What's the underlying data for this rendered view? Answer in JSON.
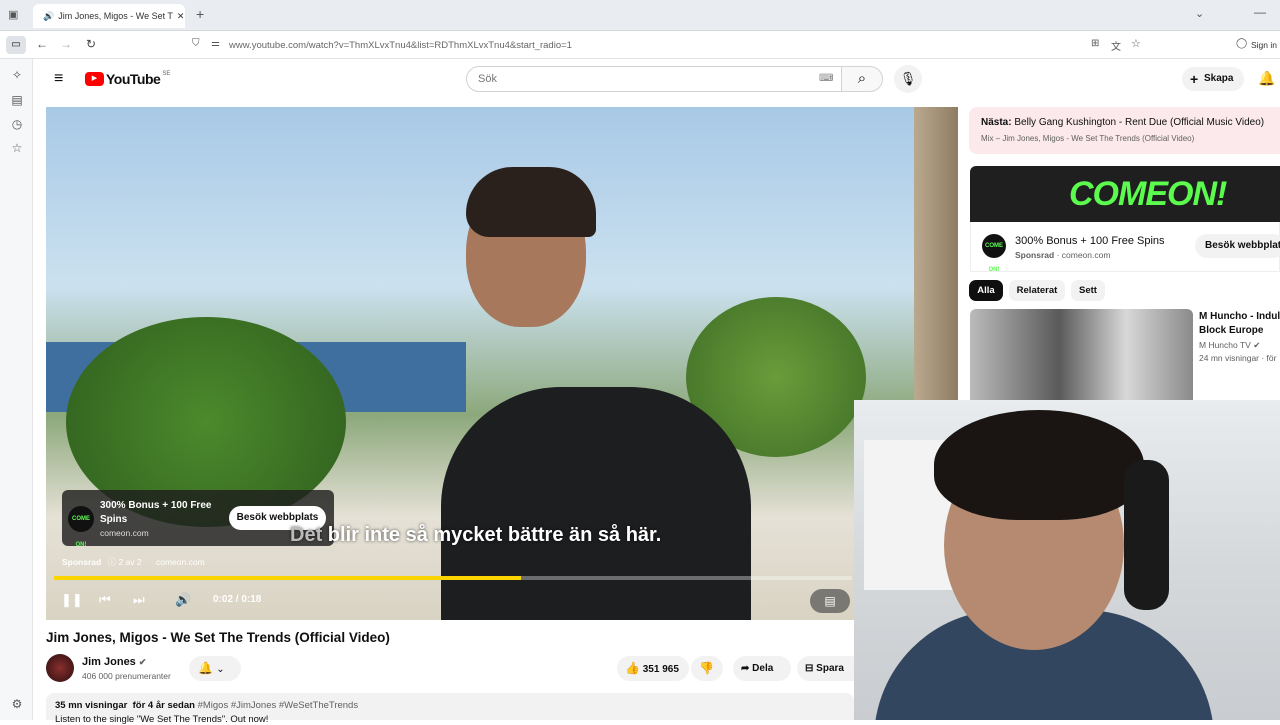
{
  "browser": {
    "tab_title": "Jim Jones, Migos - We Set T",
    "url": "www.youtube.com/watch?v=ThmXLvxTnu4&list=RDThmXLvxTnu4&start_radio=1",
    "sign_in": "Sign in"
  },
  "header": {
    "logo": "YouTube",
    "region": "SE",
    "search_placeholder": "Sök",
    "create_label": "Skapa"
  },
  "player": {
    "ad_title": "300% Bonus + 100 Free Spins",
    "ad_domain": "comeon.com",
    "ad_button": "Besök webbplats",
    "subtitle_dim": "Det",
    "subtitle_text": " blir inte så mycket bättre än så här.",
    "sponsored": "Sponsrad",
    "ad_count": "2 av 2",
    "sponsor_domain": "comeon.com",
    "time": "0:02 / 0:18",
    "progress": 0.585,
    "ad_logo_text": "COME ON!"
  },
  "video": {
    "title": "Jim Jones, Migos - We Set The Trends (Official Video)",
    "channel": "Jim Jones",
    "subscribers": "406 000 prenumeranter",
    "likes": "351 965",
    "share": "Dela",
    "save": "Spara",
    "views": "35 mn visningar",
    "age": "för 4 år sedan",
    "tags": "#Migos #JimJones #WeSetTheTrends",
    "desc_line2": "Listen to the single \"We Set The Trends\". Out now!"
  },
  "side": {
    "next_label": "Nästa:",
    "next_title": "Belly Gang Kushington - Rent Due (Official Music Video)",
    "next_sub": "Mix – Jim Jones, Migos - We Set The Trends (Official Video)",
    "banner_text": "COMEON!",
    "ad_title": "300% Bonus + 100 Free Spins",
    "ad_sponsored": "Sponsrad",
    "ad_domain": "comeon.com",
    "ad_button": "Besök webbplats",
    "chips": [
      "Alla",
      "Relaterat",
      "Sett"
    ],
    "related_title_1": "M Huncho - Indulg",
    "related_title_2": "Block Europe",
    "related_channel": "M Huncho TV",
    "related_meta": "24 mn visningar · för"
  }
}
